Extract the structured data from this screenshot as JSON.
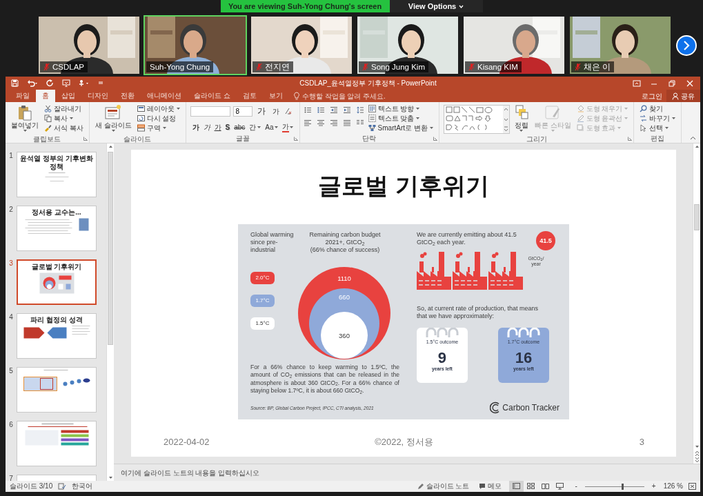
{
  "zoom": {
    "banner": "You are viewing Suh-Yong Chung's screen",
    "view_options": "View Options",
    "participants": [
      {
        "name": "CSDLAP",
        "muted": true,
        "speaking": false
      },
      {
        "name": "Suh-Yong Chung",
        "muted": false,
        "speaking": true
      },
      {
        "name": "전지연",
        "muted": true,
        "speaking": false
      },
      {
        "name": "Song Jung Kim",
        "muted": true,
        "speaking": false
      },
      {
        "name": "Kisang KIM",
        "muted": true,
        "speaking": false
      },
      {
        "name": "채은 이",
        "muted": true,
        "speaking": false
      }
    ]
  },
  "window": {
    "title": "CSDLAP_윤석열정부 기후정책 - PowerPoint"
  },
  "tabs": [
    {
      "label": "파일",
      "selected": false
    },
    {
      "label": "홈",
      "selected": true
    },
    {
      "label": "삽입",
      "selected": false
    },
    {
      "label": "디자인",
      "selected": false
    },
    {
      "label": "전환",
      "selected": false
    },
    {
      "label": "애니메이션",
      "selected": false
    },
    {
      "label": "슬라이드 쇼",
      "selected": false
    },
    {
      "label": "검토",
      "selected": false
    },
    {
      "label": "보기",
      "selected": false
    }
  ],
  "tell_me": {
    "placeholder": "수행할 작업을 알려 주세요."
  },
  "account": {
    "sign_in": "로그인",
    "share": "공유"
  },
  "ribbon": {
    "groups": [
      {
        "kind": "clipboard",
        "label": "클립보드",
        "launcher": true,
        "large": [
          {
            "label": "붙여넣기",
            "dropdown": true,
            "disabled": false
          }
        ],
        "items": [
          {
            "label": "잘라내기",
            "dropdown": false,
            "disabled": false
          },
          {
            "label": "복사",
            "dropdown": true,
            "disabled": false
          },
          {
            "label": "서식 복사",
            "dropdown": false,
            "disabled": false
          }
        ]
      },
      {
        "kind": "slides",
        "label": "슬라이드",
        "launcher": false,
        "large": [
          {
            "label": "새 슬라이드",
            "dropdown": true,
            "disabled": false
          }
        ],
        "items": [
          {
            "label": "레이아웃",
            "dropdown": true,
            "disabled": false
          },
          {
            "label": "다시 설정",
            "dropdown": false,
            "disabled": false
          },
          {
            "label": "구역",
            "dropdown": true,
            "disabled": false
          }
        ]
      },
      {
        "kind": "font",
        "label": "글꼴",
        "launcher": true,
        "font_size": "8",
        "size_buttons": [
          "가",
          "가"
        ],
        "format_buttons": [
          "가",
          "가",
          "가",
          "S",
          "abc",
          "간",
          "Aa",
          "가"
        ]
      },
      {
        "kind": "paragraph",
        "label": "단락",
        "launcher": true,
        "items": [
          {
            "label": "텍스트 방향",
            "dropdown": true,
            "disabled": false
          },
          {
            "label": "텍스트 맞춤",
            "dropdown": true,
            "disabled": false
          },
          {
            "label": "SmartArt로 변환",
            "dropdown": true,
            "disabled": false
          }
        ]
      },
      {
        "kind": "drawing",
        "label": "그리기",
        "launcher": true,
        "large": [
          {
            "label": "정렬",
            "dropdown": true,
            "disabled": false
          },
          {
            "label": "빠른 스타일",
            "dropdown": true,
            "disabled": true
          }
        ],
        "items": [
          {
            "label": "도형 채우기",
            "dropdown": true,
            "disabled": true
          },
          {
            "label": "도형 윤곽선",
            "dropdown": true,
            "disabled": true
          },
          {
            "label": "도형 효과",
            "dropdown": true,
            "disabled": true
          }
        ]
      },
      {
        "kind": "editing",
        "label": "편집",
        "launcher": false,
        "items": [
          {
            "label": "찾기",
            "dropdown": false,
            "disabled": false
          },
          {
            "label": "바꾸기",
            "dropdown": true,
            "disabled": false
          },
          {
            "label": "선택",
            "dropdown": true,
            "disabled": false
          }
        ]
      }
    ]
  },
  "slides": [
    {
      "number": "1",
      "title": "윤석열 정부의 기후변화 정책",
      "selected": false
    },
    {
      "number": "2",
      "title": "정서용 교수는...",
      "selected": false
    },
    {
      "number": "3",
      "title": "글로벌 기후위기",
      "selected": true
    },
    {
      "number": "4",
      "title": "파리 협정의 성격",
      "selected": false
    },
    {
      "number": "5",
      "selected": false
    },
    {
      "number": "6",
      "selected": false
    },
    {
      "number": "7",
      "selected": false
    }
  ],
  "slide": {
    "title": "글로벌 기후위기",
    "infographic": {
      "warming_heading": "Global warming since pre-industrial",
      "budget_heading": [
        "Remaining carbon budget",
        "2021+, GtCO$_{2}$",
        "(66% chance of success)"
      ],
      "scenarios": [
        {
          "label": "2.0°C",
          "budget": "1110",
          "color": "#e8423f"
        },
        {
          "label": "1.7°C",
          "budget": "660",
          "color": "#8fa9d9"
        },
        {
          "label": "1.5°C",
          "budget": "360",
          "color": "#ffffff"
        }
      ],
      "note": "For a 66% chance to keep warming to 1.5ºC, the amount of CO$_{2}$ emissions that can be released in the atmosphere is about 360 GtCO$_{2}$. For a 66% chance of staying below 1.7ºC, it is about 660 GtCO$_{2}$.",
      "source": "Source: BP, Global Carbon Project, IPCC, CTI analysis, 2021",
      "emissions_heading": "We are currently emitting about 41.5 GtCO$_{2}$ each year.",
      "emissions_badge": "41.5",
      "emissions_unit": "GtCO$_{2}$/ year",
      "outlook": "So, at current rate of production, that means that we have approximately:",
      "outcomes": [
        {
          "caption": "1.5°C outcome",
          "years": "9",
          "suffix": "years left",
          "color": "#ffffff"
        },
        {
          "caption": "1.7°C outcome",
          "years": "16",
          "suffix": "years left",
          "color": "#8fa9d9"
        }
      ],
      "logo": "Carbon Tracker"
    },
    "footer": {
      "date": "2022-04-02",
      "copyright": "©2022, 정서용",
      "number": "3"
    }
  },
  "notes": {
    "placeholder": "여기에 슬라이드 노트의 내용을 입력하십시오"
  },
  "status": {
    "slide": "슬라이드 3/10",
    "language": "한국어",
    "notes": "슬라이드 노트",
    "comments": "메모",
    "views": [
      {
        "selected": true
      },
      {
        "selected": false
      },
      {
        "selected": false
      },
      {
        "selected": false
      }
    ],
    "zoom_out": "-",
    "zoom_in": "+",
    "zoom": {
      "level": 0.63
    },
    "zoom_text": "126 %"
  }
}
